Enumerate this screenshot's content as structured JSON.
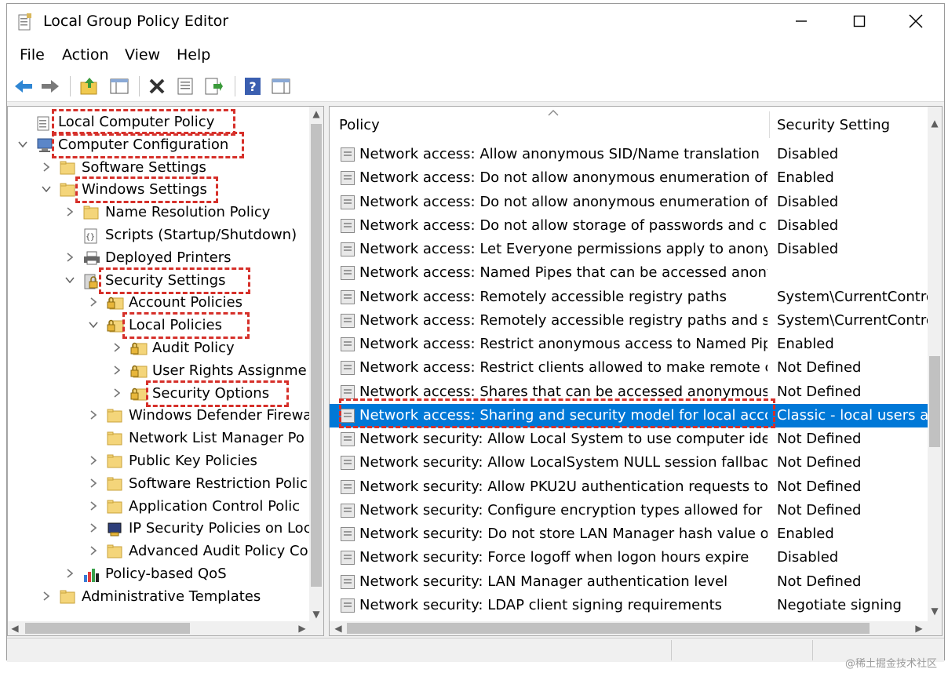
{
  "window": {
    "title": "Local Group Policy Editor"
  },
  "menu": [
    "File",
    "Action",
    "Help",
    "View"
  ],
  "menu_ordered": [
    "File",
    "Action",
    "View",
    "Help"
  ],
  "toolbar": [
    "back-icon",
    "forward-icon",
    "up-folder-icon",
    "show-hide-tree-icon",
    "delete-icon",
    "properties-icon",
    "export-list-icon",
    "help-icon",
    "console-icon"
  ],
  "tree": [
    {
      "label": "Local Computer Policy",
      "level": 0,
      "expander": "",
      "icon": "policy",
      "hl": true
    },
    {
      "label": "Computer Configuration",
      "level": 0,
      "expander": "v",
      "icon": "computer",
      "hl": true
    },
    {
      "label": "Software Settings",
      "level": 1,
      "expander": ">",
      "icon": "folder",
      "hl": false
    },
    {
      "label": "Windows Settings",
      "level": 1,
      "expander": "v",
      "icon": "folder",
      "hl": true
    },
    {
      "label": "Name Resolution Policy",
      "level": 2,
      "expander": ">",
      "icon": "folder",
      "hl": false
    },
    {
      "label": "Scripts (Startup/Shutdown)",
      "level": 2,
      "expander": "",
      "icon": "script",
      "hl": false
    },
    {
      "label": "Deployed Printers",
      "level": 2,
      "expander": ">",
      "icon": "printer",
      "hl": false
    },
    {
      "label": "Security Settings",
      "level": 2,
      "expander": "v",
      "icon": "security",
      "hl": true
    },
    {
      "label": "Account Policies",
      "level": 3,
      "expander": ">",
      "icon": "lockfolder",
      "hl": false
    },
    {
      "label": "Local Policies",
      "level": 3,
      "expander": "v",
      "icon": "lockfolder",
      "hl": true
    },
    {
      "label": "Audit Policy",
      "level": 4,
      "expander": ">",
      "icon": "lockfolder",
      "hl": false
    },
    {
      "label": "User Rights Assignme",
      "level": 4,
      "expander": ">",
      "icon": "lockfolder",
      "hl": false
    },
    {
      "label": "Security Options",
      "level": 4,
      "expander": ">",
      "icon": "lockfolder",
      "hl": true
    },
    {
      "label": "Windows Defender Firewa",
      "level": 3,
      "expander": ">",
      "icon": "folder",
      "hl": false
    },
    {
      "label": "Network List Manager Po",
      "level": 3,
      "expander": "",
      "icon": "folder",
      "hl": false
    },
    {
      "label": "Public Key Policies",
      "level": 3,
      "expander": ">",
      "icon": "folder",
      "hl": false
    },
    {
      "label": "Software Restriction Polic",
      "level": 3,
      "expander": ">",
      "icon": "folder",
      "hl": false
    },
    {
      "label": "Application Control Polic",
      "level": 3,
      "expander": ">",
      "icon": "folder",
      "hl": false
    },
    {
      "label": "IP Security Policies on Loc",
      "level": 3,
      "expander": ">",
      "icon": "ipsec",
      "hl": false
    },
    {
      "label": "Advanced Audit Policy Co",
      "level": 3,
      "expander": ">",
      "icon": "folder",
      "hl": false
    },
    {
      "label": "Policy-based QoS",
      "level": 2,
      "expander": ">",
      "icon": "qos",
      "hl": false
    },
    {
      "label": "Administrative Templates",
      "level": 1,
      "expander": ">",
      "icon": "folder",
      "hl": false
    }
  ],
  "columns": {
    "policy": "Policy",
    "setting": "Security Setting"
  },
  "policies": [
    {
      "name": "Network access: Allow anonymous SID/Name translation",
      "setting": "Disabled"
    },
    {
      "name": "Network access: Do not allow anonymous enumeration of S...",
      "setting": "Enabled"
    },
    {
      "name": "Network access: Do not allow anonymous enumeration of S...",
      "setting": "Disabled"
    },
    {
      "name": "Network access: Do not allow storage of passwords and cre...",
      "setting": "Disabled"
    },
    {
      "name": "Network access: Let Everyone permissions apply to anonym...",
      "setting": "Disabled"
    },
    {
      "name": "Network access: Named Pipes that can be accessed anonym...",
      "setting": ""
    },
    {
      "name": "Network access: Remotely accessible registry paths",
      "setting": "System\\CurrentContro"
    },
    {
      "name": "Network access: Remotely accessible registry paths and sub...",
      "setting": "System\\CurrentContro"
    },
    {
      "name": "Network access: Restrict anonymous access to Named Pipes...",
      "setting": "Enabled"
    },
    {
      "name": "Network access: Restrict clients allowed to make remote call...",
      "setting": "Not Defined"
    },
    {
      "name": "Network access: Shares that can be accessed anonymously",
      "setting": "Not Defined"
    },
    {
      "name": "Network access: Sharing and security model for local accou...",
      "setting": "Classic - local users au",
      "selected": true
    },
    {
      "name": "Network security: Allow Local System to use computer ident...",
      "setting": "Not Defined"
    },
    {
      "name": "Network security: Allow LocalSystem NULL session fallback",
      "setting": "Not Defined"
    },
    {
      "name": "Network security: Allow PKU2U authentication requests to t...",
      "setting": "Not Defined"
    },
    {
      "name": "Network security: Configure encryption types allowed for Ke...",
      "setting": "Not Defined"
    },
    {
      "name": "Network security: Do not store LAN Manager hash value on ...",
      "setting": "Enabled"
    },
    {
      "name": "Network security: Force logoff when logon hours expire",
      "setting": "Disabled"
    },
    {
      "name": "Network security: LAN Manager authentication level",
      "setting": "Not Defined"
    },
    {
      "name": "Network security: LDAP client signing requirements",
      "setting": "Negotiate signing"
    }
  ],
  "watermark": "@稀土掘金技术社区",
  "colors": {
    "highlight": "#d6302a",
    "selection": "#0078d7"
  }
}
